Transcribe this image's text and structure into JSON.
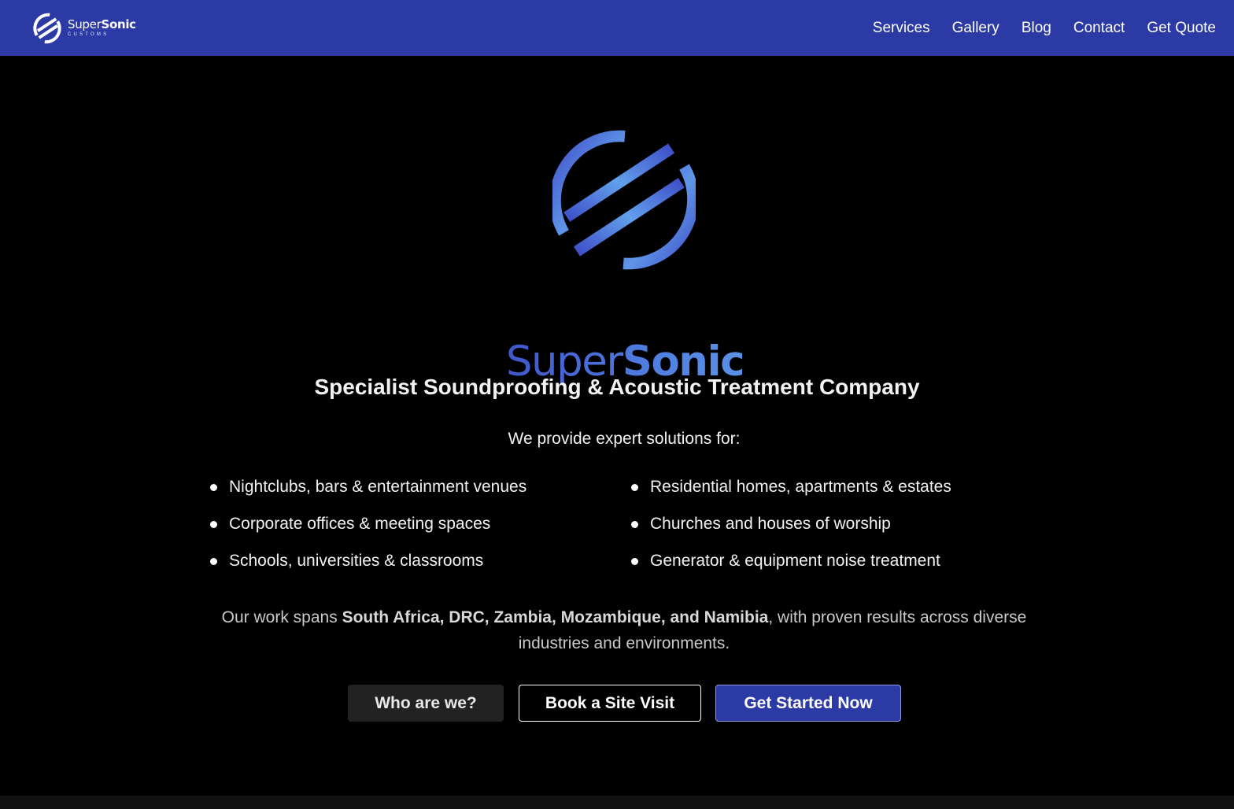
{
  "brand": {
    "name_light": "Super",
    "name_bold": "Sonic",
    "sub": "CUSTOMS",
    "logo_icon": "supersonic-logo-icon"
  },
  "nav": {
    "items": [
      {
        "label": "Services"
      },
      {
        "label": "Gallery"
      },
      {
        "label": "Blog"
      },
      {
        "label": "Contact"
      },
      {
        "label": "Get Quote"
      }
    ]
  },
  "hero": {
    "wordmark_light": "Super",
    "wordmark_bold": "Sonic",
    "tagline": "Specialist Soundproofing & Acoustic Treatment Company",
    "intro": "We provide expert solutions for:",
    "services_left": [
      "Nightclubs, bars & entertainment venues",
      "Corporate offices & meeting spaces",
      "Schools, universities & classrooms"
    ],
    "services_right": [
      "Residential homes, apartments & estates",
      "Churches and houses of worship",
      "Generator & equipment noise treatment"
    ],
    "coverage_prefix": "Our work spans ",
    "coverage_countries": "South Africa, DRC, Zambia, Mozambique, and Namibia",
    "coverage_suffix": ", with proven results across diverse industries and environments."
  },
  "cta": {
    "who_label": "Who are we?",
    "visit_label": "Book a Site Visit",
    "start_label": "Get Started Now"
  },
  "colors": {
    "header_bg": "#2c3aa6",
    "page_bg": "#000000",
    "accent_light": "#5f95e8",
    "accent_dark": "#3f51c9"
  }
}
